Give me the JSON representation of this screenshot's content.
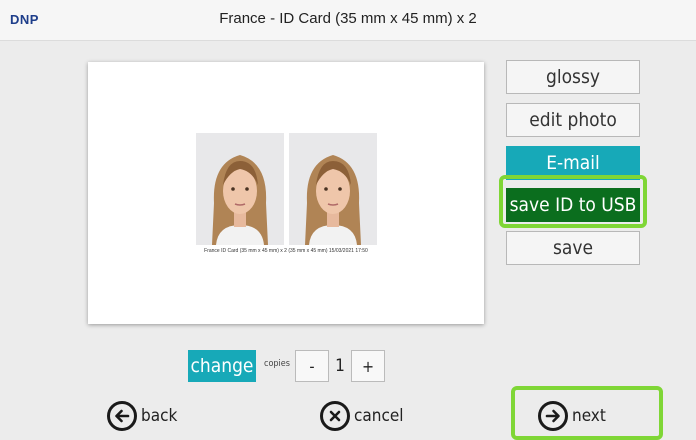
{
  "header": {
    "logo": "DNP",
    "title": "France - ID Card (35 mm x 45 mm) x 2"
  },
  "preview": {
    "caption": "France ID Card (35 mm x 45 mm) x 2 (35 mm x 45 mm) 15/03/2021 17:50"
  },
  "side_buttons": {
    "glossy": "glossy",
    "edit_photo": "edit photo",
    "email": "E-mail",
    "save_usb": "save ID to USB",
    "save": "save"
  },
  "copies": {
    "change_label": "change",
    "label": "copies",
    "minus": "-",
    "value": "1",
    "plus": "+"
  },
  "nav": {
    "back": "back",
    "cancel": "cancel",
    "next": "next"
  },
  "colors": {
    "accent": "#17a9b8",
    "usb": "#0b6e1e",
    "highlight": "#7fd636"
  }
}
